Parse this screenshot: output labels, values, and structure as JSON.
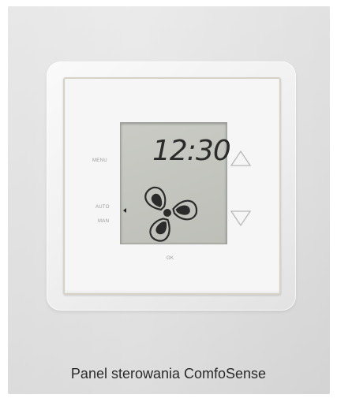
{
  "display": {
    "time": "12:30"
  },
  "labels": {
    "menu": "MENU",
    "auto": "AUTO",
    "man": "MAN",
    "ok": "OK"
  },
  "icons": {
    "up": "triangle-up-icon",
    "down": "triangle-down-icon",
    "fan": "fan-icon",
    "mode_indicator": "arrow-left-icon"
  },
  "caption": "Panel sterowania ComfoSense",
  "colors": {
    "background": "#e3e3e3",
    "lcd": "#c3c5be",
    "lcd_segments": "#2b2b2b",
    "plate": "#f6f6f6"
  }
}
